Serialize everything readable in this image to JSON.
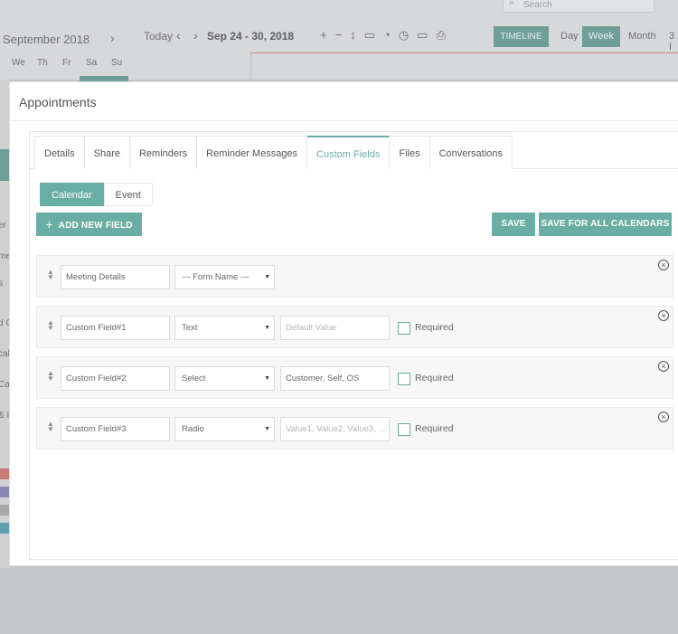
{
  "background": {
    "search_placeholder": "Search",
    "month_title": "September 2018",
    "weekdays": [
      "We",
      "Th",
      "Fr",
      "Sa",
      "Su"
    ],
    "today_label": "Today",
    "date_range": "Sep 24 - 30, 2018",
    "views": {
      "timeline": "TIMELINE",
      "day": "Day",
      "week": "Week",
      "month": "Month",
      "three": "3 I"
    },
    "sidebar_fragments": [
      "er",
      "me",
      "s",
      "d C",
      "cal",
      "Ca",
      "& I"
    ]
  },
  "modal": {
    "title": "Appointments",
    "tabs": [
      {
        "label": "Details"
      },
      {
        "label": "Share"
      },
      {
        "label": "Reminders"
      },
      {
        "label": "Reminder Messages"
      },
      {
        "label": "Custom Fields"
      },
      {
        "label": "Files"
      },
      {
        "label": "Conversations"
      }
    ],
    "active_tab": "Custom Fields",
    "subtabs": [
      {
        "label": "Calendar"
      },
      {
        "label": "Event"
      }
    ],
    "active_subtab": "Calendar",
    "add_button": "ADD NEW FIELD",
    "save_button": "SAVE",
    "save_all_button": "SAVE FOR ALL CALENDARS",
    "required_label": "Required",
    "fields": [
      {
        "name": "Meeting Details",
        "type": "--- Form Name ---",
        "default": "",
        "has_required": false
      },
      {
        "name": "Custom Field#1",
        "type": "Text",
        "default_placeholder": "Default Value",
        "has_required": true
      },
      {
        "name": "Custom Field#2",
        "type": "Select",
        "default": "Customer, Self, OS",
        "has_required": true
      },
      {
        "name": "Custom Field#3",
        "type": "Radio",
        "default_placeholder": "Value1, Value2, Value3, ...",
        "has_required": true
      }
    ]
  },
  "colors": {
    "accent": "#6aada4",
    "overlay": "#c4c6c8"
  }
}
